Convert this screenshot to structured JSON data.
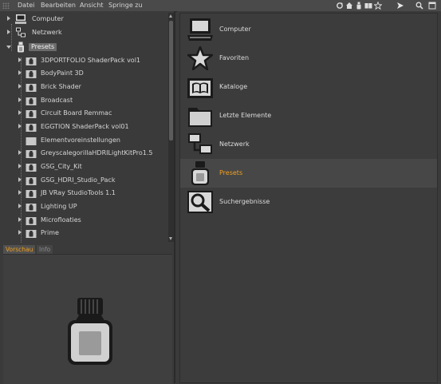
{
  "menubar": {
    "items": [
      "Datei",
      "Bearbeiten",
      "Ansicht",
      "Springe zu"
    ],
    "toolbar_icons": [
      "refresh-icon",
      "home-icon",
      "bottle-icon",
      "book-icon",
      "star-icon",
      "arrow-right-icon",
      "search-icon",
      "window-icon"
    ]
  },
  "tree": {
    "items": [
      {
        "label": "Computer",
        "icon": "computer-icon",
        "level": 0
      },
      {
        "label": "Netzwerk",
        "icon": "network-icon",
        "level": 0
      },
      {
        "label": "Presets",
        "icon": "bottle-icon",
        "level": 0,
        "selected": true,
        "expanded": true
      },
      {
        "label": "3DPORTFOLIO ShaderPack vol1",
        "icon": "preset-folder-icon",
        "level": 1
      },
      {
        "label": "BodyPaint 3D",
        "icon": "preset-folder-icon",
        "level": 1
      },
      {
        "label": "Brick Shader",
        "icon": "preset-folder-icon",
        "level": 1
      },
      {
        "label": "Broadcast",
        "icon": "preset-folder-icon",
        "level": 1
      },
      {
        "label": "Circuit Board Remmac",
        "icon": "preset-folder-icon",
        "level": 1
      },
      {
        "label": "EGGTION ShaderPack vol01",
        "icon": "preset-folder-icon",
        "level": 1
      },
      {
        "label": "Elementvoreinstellungen",
        "icon": "folder-icon",
        "level": 1
      },
      {
        "label": "GreyscalegorillaHDRILightKitPro1.5",
        "icon": "preset-folder-icon",
        "level": 1
      },
      {
        "label": "GSG_City_Kit",
        "icon": "preset-folder-icon",
        "level": 1
      },
      {
        "label": "GSG_HDRI_Studio_Pack",
        "icon": "preset-folder-icon",
        "level": 1
      },
      {
        "label": "JB VRay StudioTools 1.1",
        "icon": "preset-folder-icon",
        "level": 1
      },
      {
        "label": "Lighting UP",
        "icon": "preset-folder-icon",
        "level": 1
      },
      {
        "label": "Microfloaties",
        "icon": "preset-folder-icon",
        "level": 1
      },
      {
        "label": "Prime",
        "icon": "preset-folder-icon",
        "level": 1
      }
    ]
  },
  "bottom_tabs": [
    "Vorschau",
    "Info"
  ],
  "preview": {
    "icon": "bottle-icon"
  },
  "locations": [
    {
      "label": "Computer",
      "icon": "computer-icon"
    },
    {
      "label": "Favoriten",
      "icon": "star-icon"
    },
    {
      "label": "Kataloge",
      "icon": "book-icon"
    },
    {
      "label": "Letzte Elemente",
      "icon": "folder-icon"
    },
    {
      "label": "Netzwerk",
      "icon": "network-icon"
    },
    {
      "label": "Presets",
      "icon": "bottle-icon",
      "selected": true
    },
    {
      "label": "Suchergebnisse",
      "icon": "search-icon"
    }
  ],
  "colors": {
    "accent": "#f0a020",
    "background": "#3a3a3a",
    "selected_row": "#474747"
  }
}
